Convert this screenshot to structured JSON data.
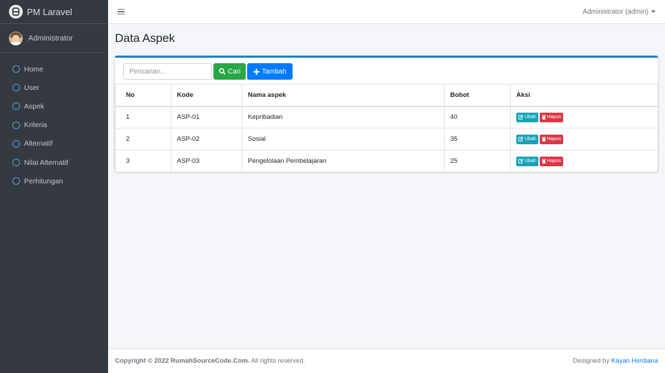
{
  "app": {
    "brand": "PM Laravel"
  },
  "user_panel": {
    "name": "Administrator"
  },
  "sidebar": {
    "items": [
      {
        "label": "Home"
      },
      {
        "label": "User"
      },
      {
        "label": "Aspek"
      },
      {
        "label": "Kriteria"
      },
      {
        "label": "Alternatif"
      },
      {
        "label": "Nilai Alternatif"
      },
      {
        "label": "Perhitungan"
      }
    ]
  },
  "topbar": {
    "user_menu": "Administrator (admin)"
  },
  "page": {
    "title": "Data Aspek"
  },
  "toolbar": {
    "search_placeholder": "Pencarian...",
    "search_value": "",
    "search_button": "Cari",
    "add_button": "Tambah"
  },
  "table": {
    "headers": [
      "No",
      "Kode",
      "Nama aspek",
      "Bobot",
      "Aksi"
    ],
    "rows": [
      {
        "no": "1",
        "kode": "ASP-01",
        "nama": "Kepribadian",
        "bobot": "40"
      },
      {
        "no": "2",
        "kode": "ASP-02",
        "nama": "Sosial",
        "bobot": "35"
      },
      {
        "no": "3",
        "kode": "ASP-03",
        "nama": "Pengelolaan Pembelajaran",
        "bobot": "25"
      }
    ],
    "edit_label": "Ubah",
    "delete_label": "Hapus"
  },
  "footer": {
    "copyright": "Copyright © 2022 RumahSourceCode.Com.",
    "rights": "All rights reserved.",
    "designed_by": "Designed by",
    "designer": "Kayan Herdiana"
  },
  "colors": {
    "sidebar_bg": "#343a40",
    "primary": "#007bff",
    "success": "#28a745",
    "info": "#17a2b8",
    "danger": "#dc3545"
  }
}
